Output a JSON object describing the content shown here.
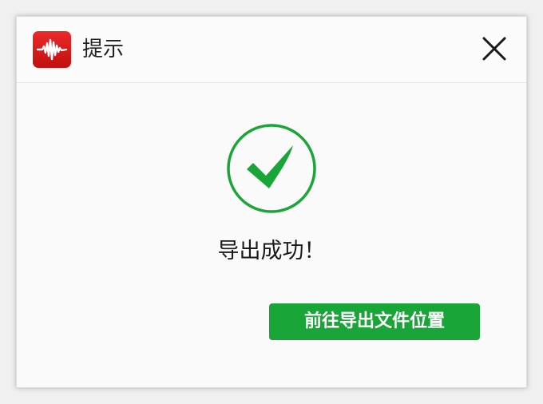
{
  "dialog": {
    "title": "提示",
    "app_icon": "waveform-icon",
    "close_icon": "close-icon"
  },
  "content": {
    "status_icon": "checkmark-circle-icon",
    "message": "导出成功！",
    "action_label": "前往导出文件位置"
  },
  "colors": {
    "brand_red": "#d61b1b",
    "success_green": "#1aa538"
  }
}
